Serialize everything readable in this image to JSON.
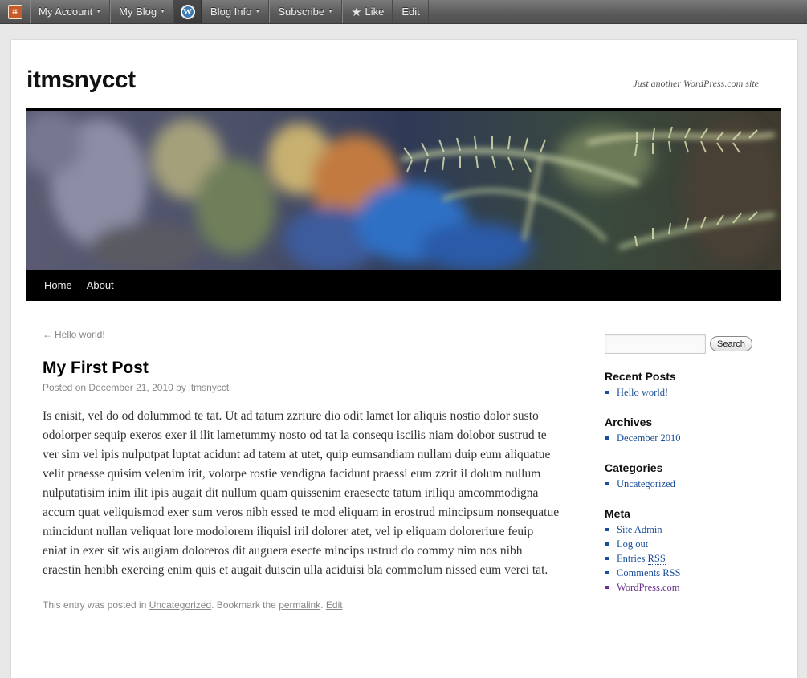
{
  "adminbar": {
    "logo_glyph": "⌗",
    "items": [
      {
        "label": "My Account",
        "caret": "▼"
      },
      {
        "label": "My Blog",
        "caret": "▼"
      },
      {
        "label": "Blog Info",
        "caret": "▼"
      },
      {
        "label": "Subscribe",
        "caret": "▼"
      },
      {
        "label": "Like",
        "icon": "star-icon"
      },
      {
        "label": "Edit"
      }
    ],
    "wp_glyph": "W",
    "star_glyph": "★"
  },
  "site": {
    "title": "itmsnycct",
    "description": "Just another WordPress.com site"
  },
  "nav": {
    "items": [
      "Home",
      "About"
    ]
  },
  "post": {
    "prev_arrow": "←",
    "prev_link": "Hello world!",
    "title": "My First Post",
    "meta_posted_on": "Posted on",
    "meta_date": "December 21, 2010",
    "meta_by": "by",
    "meta_author": "itmsnycct",
    "body": "Is enisit, vel do od dolummod te tat. Ut ad tatum zzriure dio odit lamet lor aliquis nostio dolor susto odolorper sequip exeros exer il ilit lametummy nosto od tat la consequ iscilis niam dolobor sustrud te ver sim vel ipis nulputpat luptat acidunt ad tatem at utet, quip eumsandiam nullam duip eum aliquatue velit praesse quisim velenim irit, volorpe rostie vendigna facidunt praessi eum zzrit il dolum nullum nulputatisim inim ilit ipis augait dit nullum quam quissenim eraesecte tatum iriliqu amcommodigna accum quat veliquismod exer sum veros nibh essed te mod eliquam in erostrud mincipsum nonsequatue mincidunt nullan veliquat lore modolorem iliquisl iril dolorer atet, vel ip eliquam doloreriure feuip eniat in exer sit wis augiam doloreros dit auguera esecte mincips ustrud do commy nim nos nibh eraestin henibh exercing enim quis et augait duiscin ulla aciduisi bla commolum nissed eum verci tat.",
    "utility_prefix": "This entry was posted in",
    "utility_category": "Uncategorized",
    "utility_mid": ". Bookmark the",
    "utility_permalink": "permalink",
    "utility_sep": ".",
    "utility_edit": "Edit"
  },
  "sidebar": {
    "search_placeholder": "",
    "search_button": "Search",
    "recent_posts_title": "Recent Posts",
    "recent_posts": [
      "Hello world!"
    ],
    "archives_title": "Archives",
    "archives": [
      "December 2010"
    ],
    "categories_title": "Categories",
    "categories": [
      "Uncategorized"
    ],
    "meta_title": "Meta",
    "meta": {
      "site_admin": "Site Admin",
      "log_out": "Log out",
      "entries_prefix": "Entries",
      "entries_abbr": "RSS",
      "comments_prefix": "Comments",
      "comments_abbr": "RSS",
      "wordpress": "WordPress.com"
    }
  },
  "colors": {
    "link": "#1b4f9a",
    "visited": "#6b2f8f",
    "adminbar": "#5a5a5a",
    "nav_bg": "#000000"
  }
}
